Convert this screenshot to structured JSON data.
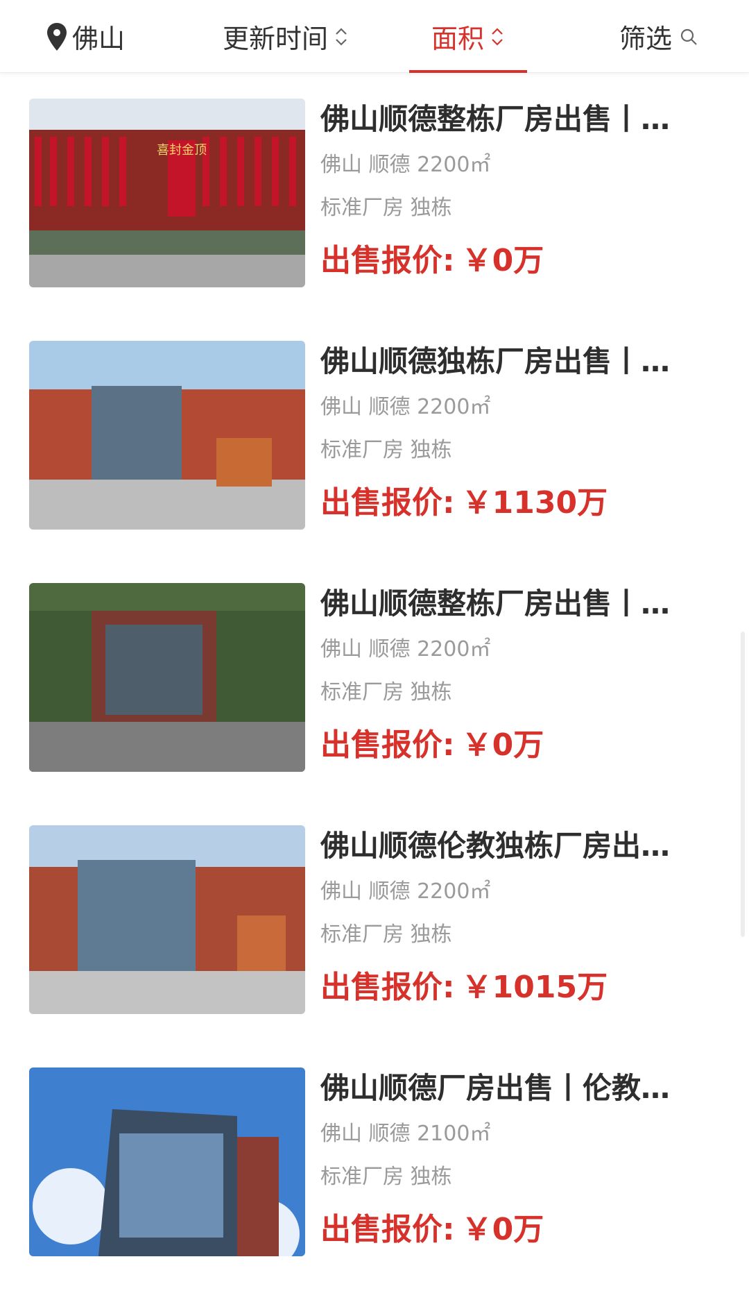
{
  "header": {
    "location_label": "佛山",
    "sort_update_label": "更新时间",
    "sort_area_label": "面积",
    "filter_label": "筛选",
    "active_tab": "面积",
    "accent_color": "#d6312a",
    "icons": {
      "location": "map-pin-icon",
      "sort": "sort-updown-icon",
      "search": "search-icon"
    }
  },
  "listings": [
    {
      "title": "佛山顺德整栋厂房出售丨…",
      "location_area": "佛山 顺德 2200㎡",
      "tags": "标准厂房 独栋",
      "price_label": "出售报价:",
      "price_value": "￥0万",
      "banner_text": "喜封金顶"
    },
    {
      "title": "佛山顺德独栋厂房出售丨…",
      "location_area": "佛山 顺德 2200㎡",
      "tags": "标准厂房 独栋",
      "price_label": "出售报价:",
      "price_value": "￥1130万"
    },
    {
      "title": "佛山顺德整栋厂房出售丨…",
      "location_area": "佛山 顺德 2200㎡",
      "tags": "标准厂房 独栋",
      "price_label": "出售报价:",
      "price_value": "￥0万"
    },
    {
      "title": "佛山顺德伦教独栋厂房出…",
      "location_area": "佛山 顺德 2200㎡",
      "tags": "标准厂房 独栋",
      "price_label": "出售报价:",
      "price_value": "￥1015万"
    },
    {
      "title": "佛山顺德厂房出售丨伦教…",
      "location_area": "佛山 顺德 2100㎡",
      "tags": "标准厂房 独栋",
      "price_label": "出售报价:",
      "price_value": "￥0万"
    }
  ]
}
